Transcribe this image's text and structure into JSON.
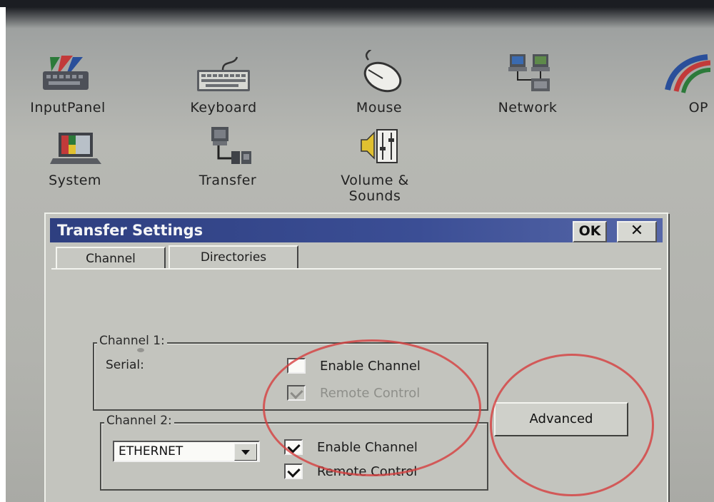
{
  "desktop": {
    "icons": [
      {
        "name": "InputPanel",
        "icon": "input-panel-icon"
      },
      {
        "name": "Keyboard",
        "icon": "keyboard-icon"
      },
      {
        "name": "Mouse",
        "icon": "mouse-icon"
      },
      {
        "name": "Network",
        "icon": "network-icon"
      },
      {
        "name": "OP",
        "icon": "op-icon"
      },
      {
        "name": "System",
        "icon": "system-icon"
      },
      {
        "name": "Transfer",
        "icon": "transfer-icon"
      },
      {
        "name": "Volume &\nSounds",
        "icon": "volume-sounds-icon"
      }
    ]
  },
  "dialog": {
    "title": "Transfer Settings",
    "ok_label": "OK",
    "close_label": "✕",
    "tabs": [
      {
        "label": "Channel",
        "active": true
      },
      {
        "label": "Directories",
        "active": false
      }
    ],
    "channel1": {
      "title": "Channel 1:",
      "field_label": "Serial:",
      "enable_label": "Enable Channel",
      "enable_checked": false,
      "remote_label": "Remote Control",
      "remote_checked": true,
      "remote_disabled": true
    },
    "channel2": {
      "title": "Channel 2:",
      "combo_value": "ETHERNET",
      "enable_label": "Enable Channel",
      "enable_checked": true,
      "remote_label": "Remote Control",
      "remote_checked": true
    },
    "advanced_label": "Advanced"
  },
  "colors": {
    "title_bar": "#2e3f80",
    "dialog_face": "#c3c4be",
    "annotation_circle": "#d63e3e"
  }
}
